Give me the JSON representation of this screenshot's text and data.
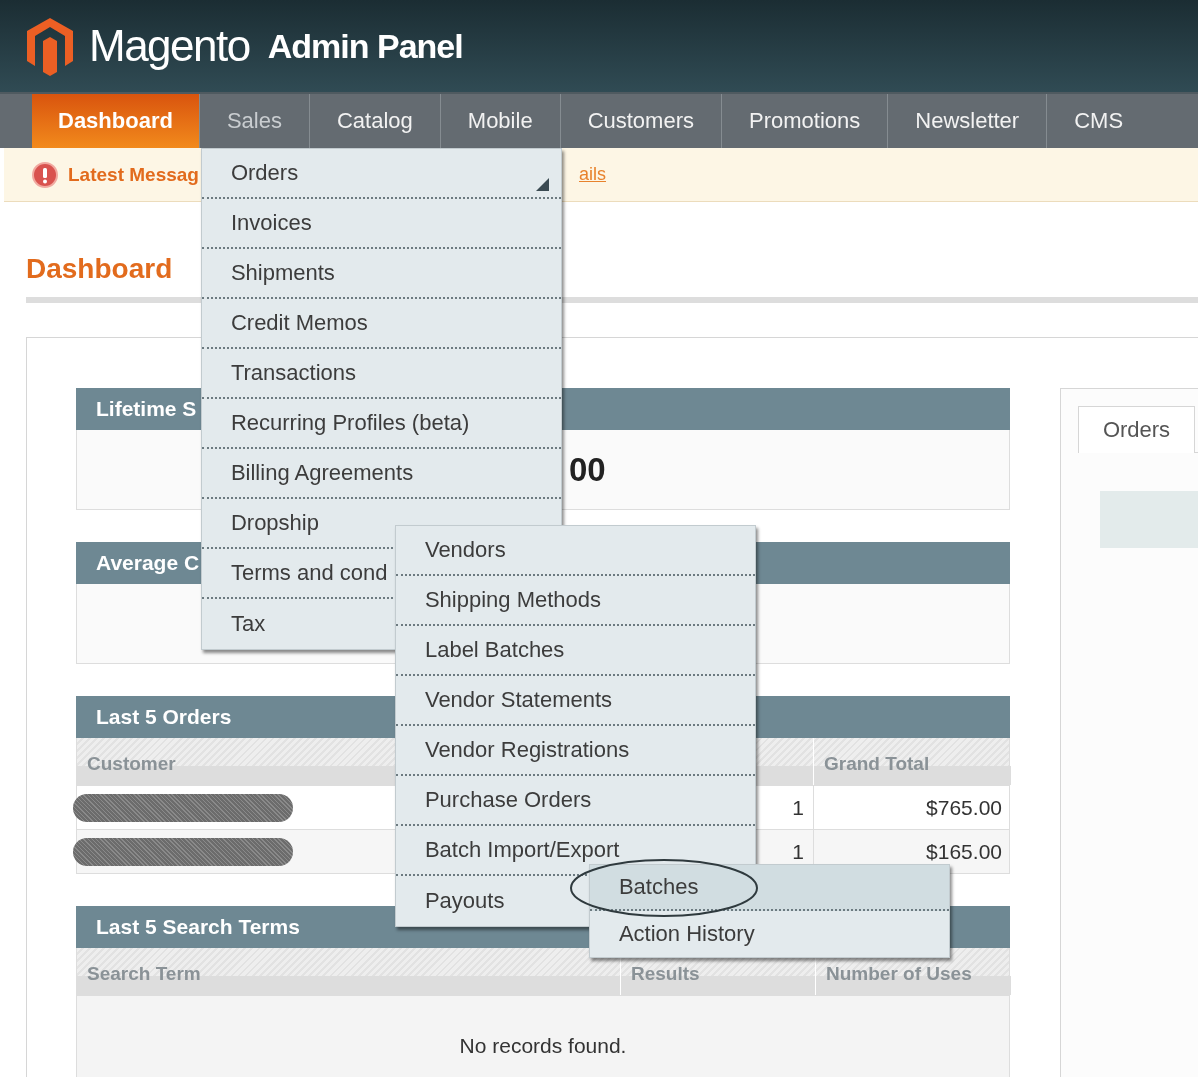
{
  "header": {
    "brand": "Magento",
    "title": "Admin Panel"
  },
  "nav": [
    {
      "label": "Dashboard",
      "selected": true,
      "expanded": false
    },
    {
      "label": "Sales",
      "selected": false,
      "expanded": true,
      "children": [
        {
          "label": "Orders",
          "selected": false,
          "arrow": true
        },
        {
          "label": "Invoices",
          "selected": false,
          "arrow": false
        },
        {
          "label": "Shipments",
          "selected": false,
          "arrow": false
        },
        {
          "label": "Credit Memos",
          "selected": false,
          "arrow": false
        },
        {
          "label": "Transactions",
          "selected": false,
          "arrow": false
        },
        {
          "label": "Recurring Profiles (beta)",
          "selected": false,
          "arrow": false
        },
        {
          "label": "Billing Agreements",
          "selected": false,
          "arrow": false
        },
        {
          "label": "Dropship",
          "selected": false,
          "arrow": false,
          "children": [
            {
              "label": "Vendors",
              "selected": false
            },
            {
              "label": "Shipping Methods",
              "selected": false
            },
            {
              "label": "Label Batches",
              "selected": false
            },
            {
              "label": "Vendor Statements",
              "selected": false
            },
            {
              "label": "Vendor Registrations",
              "selected": false
            },
            {
              "label": "Purchase Orders",
              "selected": false
            },
            {
              "label": "Batch Import/Export",
              "selected": false,
              "children": [
                {
                  "label": "Batches",
                  "selected": true,
                  "circled": true
                },
                {
                  "label": "Action History",
                  "selected": false,
                  "circled": false
                }
              ]
            },
            {
              "label": "Payouts",
              "selected": false
            }
          ]
        },
        {
          "label": "Terms and cond",
          "selected": false
        },
        {
          "label": "Tax",
          "selected": false
        }
      ]
    },
    {
      "label": "Catalog",
      "selected": false,
      "expanded": false
    },
    {
      "label": "Mobile",
      "selected": false,
      "expanded": false
    },
    {
      "label": "Customers",
      "selected": false,
      "expanded": false
    },
    {
      "label": "Promotions",
      "selected": false,
      "expanded": false
    },
    {
      "label": "Newsletter",
      "selected": false,
      "expanded": false
    },
    {
      "label": "CMS",
      "selected": false,
      "expanded": false
    }
  ],
  "message": {
    "label": "Latest Messag",
    "link": "ails"
  },
  "page_title": "Dashboard",
  "sections": [
    {
      "kind": "stat",
      "title": "Lifetime S",
      "value": "00"
    },
    {
      "kind": "stat",
      "title": "Average C"
    },
    {
      "kind": "orders",
      "title": "Last 5 Orders",
      "columns": [
        "Customer",
        "Grand Total"
      ],
      "rows": [
        {
          "customer": {
            "kind": "redacted"
          },
          "column_2": "1",
          "grand_total": "$765.00"
        },
        {
          "customer": {
            "kind": "redacted"
          },
          "column_2": "1",
          "grand_total": "$165.00"
        }
      ]
    },
    {
      "kind": "search",
      "title": "Last 5 Search Terms",
      "columns": [
        "Search Term",
        "Results",
        "Number of Uses"
      ],
      "empty_text": "No records found."
    }
  ],
  "side_panel": {
    "tabs": [
      {
        "label": "Orders",
        "selected": true
      }
    ]
  }
}
